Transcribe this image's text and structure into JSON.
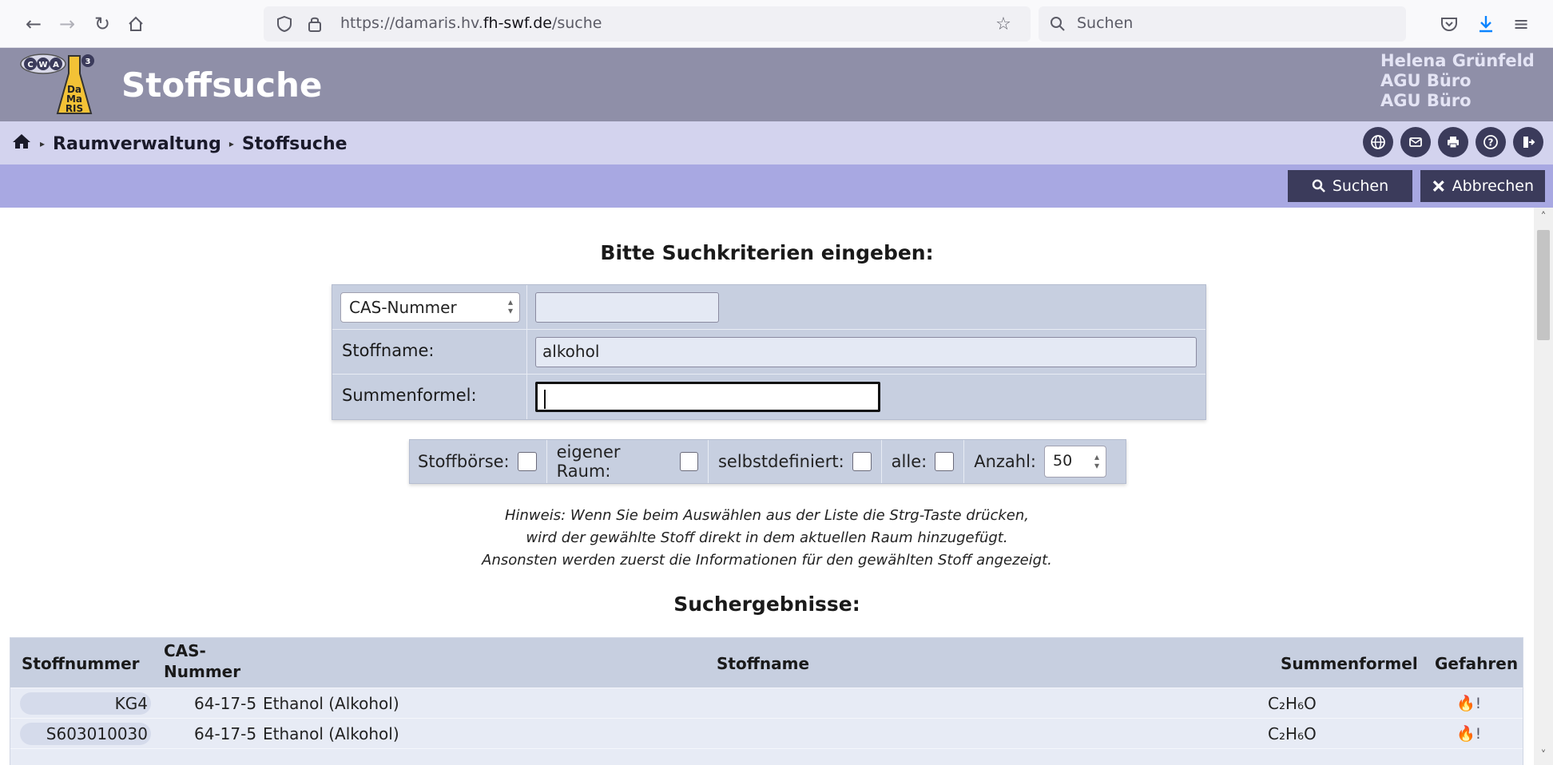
{
  "browser": {
    "url_prefix": "https://damaris.hv.",
    "url_domain": "fh-swf.de",
    "url_suffix": "/suche",
    "search_placeholder": "Suchen"
  },
  "app": {
    "title": "Stoffsuche",
    "logo_top": "CWA",
    "logo_badge": "3",
    "logo_line1": "Da",
    "logo_line2": "Ma",
    "logo_line3": "RIS",
    "user_name": "Helena Grünfeld",
    "user_line2": "AGU Büro",
    "user_line3": "AGU Büro"
  },
  "breadcrumb": {
    "items": [
      "Raumverwaltung",
      "Stoffsuche"
    ]
  },
  "actions": {
    "search_label": "Suchen",
    "cancel_label": "Abbrechen"
  },
  "form": {
    "heading": "Bitte Suchkriterien eingeben:",
    "id_type_selected": "CAS-Nummer",
    "id_value": "",
    "name_label": "Stoffname:",
    "name_value": "alkohol",
    "formula_label": "Summenformel:",
    "formula_value": ""
  },
  "filters": {
    "stoffboerse_label": "Stoffbörse:",
    "eigener_raum_label": "eigener Raum:",
    "selbstdefiniert_label": "selbstdefiniert:",
    "alle_label": "alle:",
    "anzahl_label": "Anzahl:",
    "anzahl_value": "50"
  },
  "hint": {
    "line1": "Hinweis: Wenn Sie beim Auswählen aus der Liste die Strg-Taste drücken,",
    "line2": "wird der gewählte Stoff direkt in dem aktuellen Raum hinzugefügt.",
    "line3": "Ansonsten werden zuerst die Informationen für den gewählten Stoff angezeigt."
  },
  "results": {
    "heading": "Suchergebnisse:",
    "columns": {
      "stoffnummer": "Stoffnummer",
      "cas_line1": "CAS-",
      "cas_line2": "Nummer",
      "stoffname": "Stoffname",
      "summenformel": "Summenformel",
      "gefahren": "Gefahren"
    },
    "rows": [
      {
        "stoffnummer": "KG4",
        "cas": "64-17-5",
        "name": "Ethanol (Alkohol)",
        "formula": "C₂H₆O",
        "hazards": "🔥!"
      },
      {
        "stoffnummer": "S603010030",
        "cas": "64-17-5",
        "name": "Ethanol (Alkohol)",
        "formula": "C₂H₆O",
        "hazards": "🔥!"
      }
    ]
  },
  "colors": {
    "header_bg": "#8f8fa8",
    "breadcrumb_bg": "#d3d3ee",
    "action_bar_bg": "#a8a8e2",
    "button_bg": "#3b3b5b",
    "panel_bg": "#c7cfe0"
  }
}
